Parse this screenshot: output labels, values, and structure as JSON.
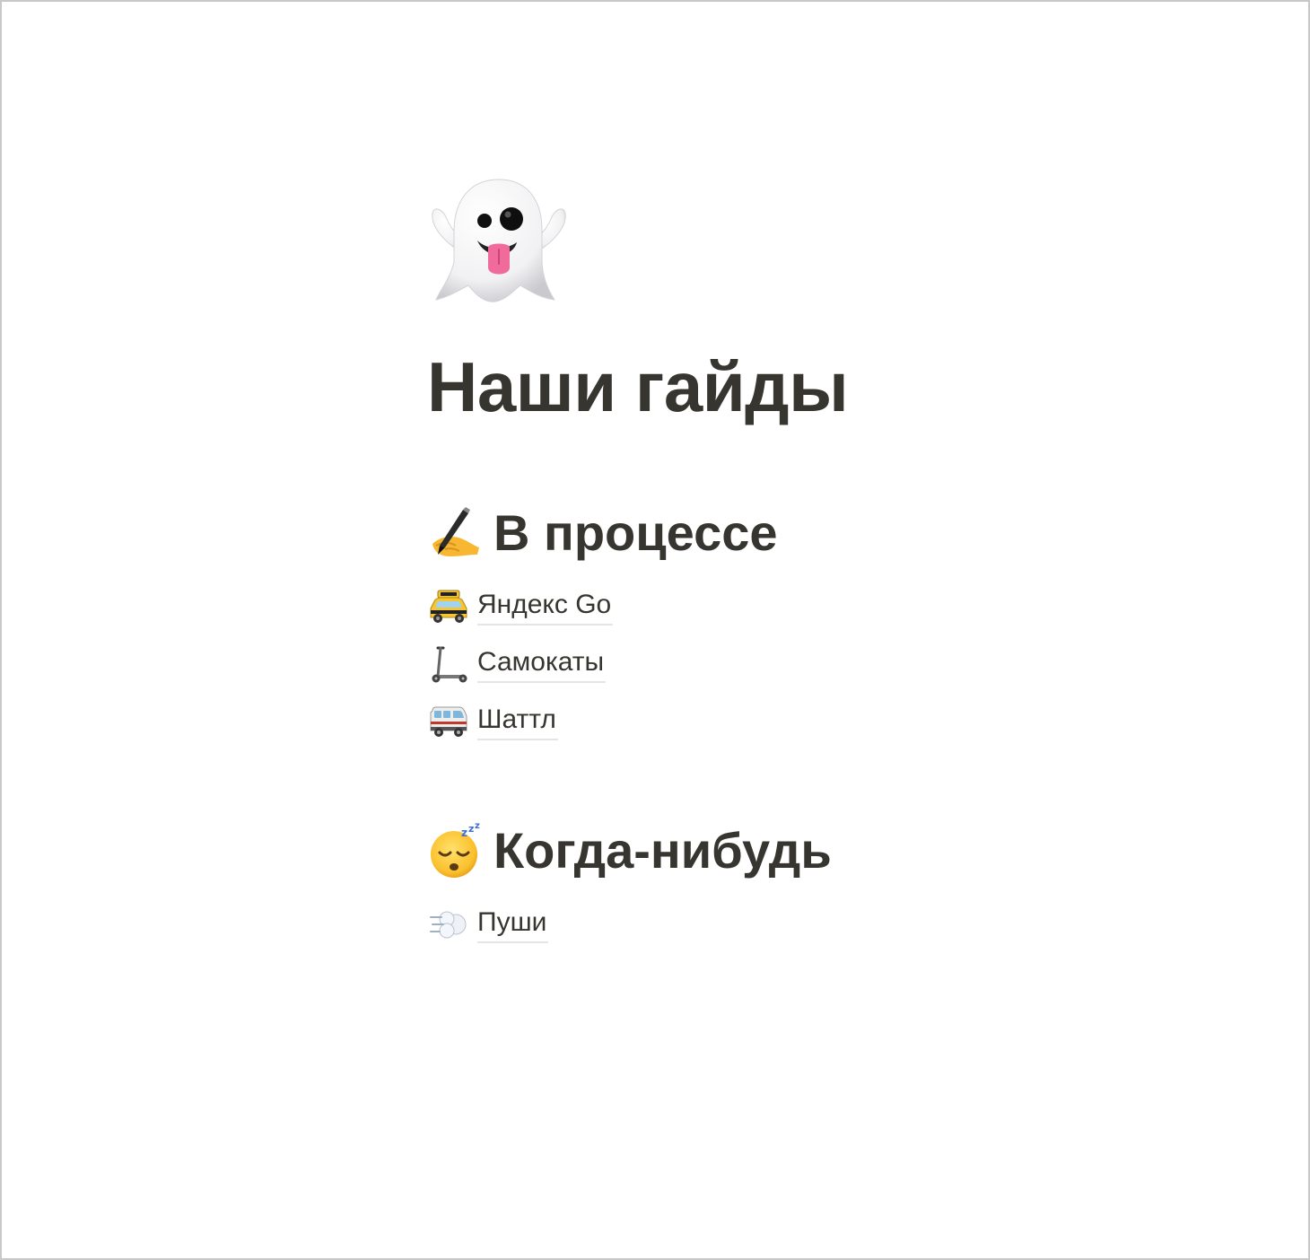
{
  "page": {
    "icon": "ghost-icon",
    "title": "Наши гайды"
  },
  "sections": [
    {
      "icon": "writing-hand-icon",
      "heading": "В процессе",
      "items": [
        {
          "icon": "taxi-icon",
          "label": "Яндекс Go"
        },
        {
          "icon": "scooter-icon",
          "label": "Самокаты"
        },
        {
          "icon": "minibus-icon",
          "label": "Шаттл"
        }
      ]
    },
    {
      "icon": "sleeping-face-icon",
      "heading": "Когда-нибудь",
      "items": [
        {
          "icon": "dash-icon",
          "label": "Пуши"
        }
      ]
    }
  ],
  "colors": {
    "text": "#37352f",
    "link_underline": "#e5e5e3",
    "frame_border": "#c8c8c8",
    "background": "#ffffff"
  }
}
